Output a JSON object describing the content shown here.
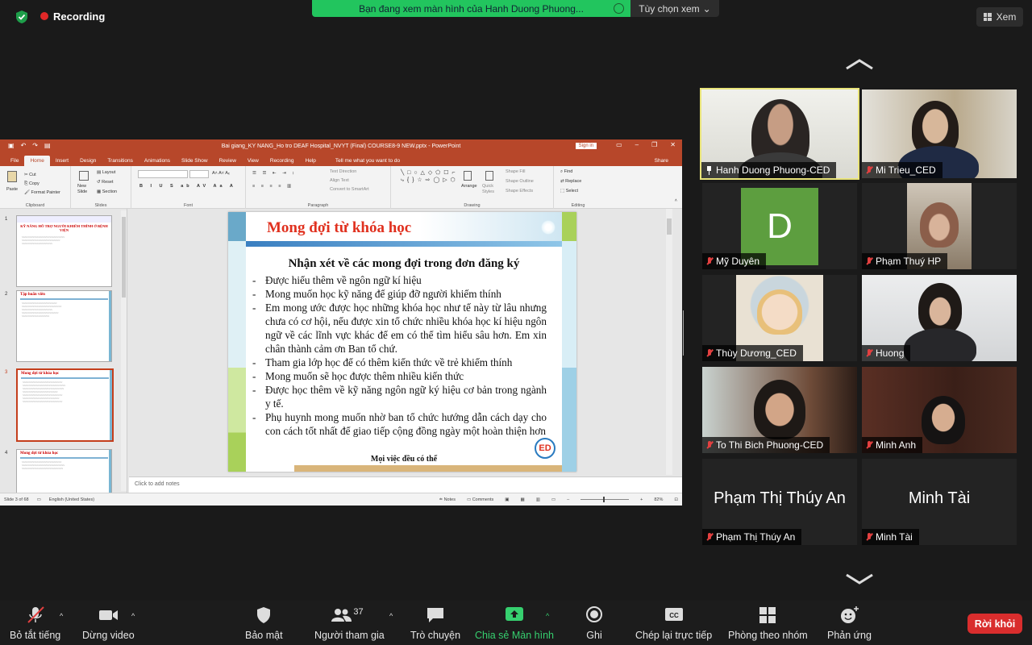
{
  "top": {
    "recording_label": "Recording",
    "share_banner": "Bạn đang xem màn hình của Hanh Duong Phuong...",
    "view_options": "Tùy chọn xem",
    "view_button": "Xem"
  },
  "ppt": {
    "window_title": "Bai giang_KY NANG_Ho tro DEAF Hospital_NVYT (Final) COURSE8-9 NEW.pptx - PowerPoint",
    "sign_in": "Sign in",
    "tabs": [
      "File",
      "Home",
      "Insert",
      "Design",
      "Transitions",
      "Animations",
      "Slide Show",
      "Review",
      "View",
      "Recording",
      "Help"
    ],
    "active_tab": "Home",
    "tell_me": "Tell me what you want to do",
    "share": "Share",
    "ribbon": {
      "clipboard": "Clipboard",
      "paste": "Paste",
      "cut": "Cut",
      "copy": "Copy",
      "format_painter": "Format Painter",
      "slides": "Slides",
      "new_slide": "New Slide",
      "layout": "Layout",
      "reset": "Reset",
      "section": "Section",
      "font": "Font",
      "paragraph": "Paragraph",
      "text_direction": "Text Direction",
      "align_text": "Align Text",
      "convert_smartart": "Convert to SmartArt",
      "drawing": "Drawing",
      "arrange": "Arrange",
      "quick_styles": "Quick Styles",
      "shape_fill": "Shape Fill",
      "shape_outline": "Shape Outline",
      "shape_effects": "Shape Effects",
      "editing": "Editing",
      "find": "Find",
      "replace": "Replace",
      "select": "Select"
    },
    "thumbnails": [
      {
        "num": "1",
        "title": "KỸ NĂNG HỖ TRỢ NGƯỜI KHIẾM THÍNH Ở BỆNH VIỆN"
      },
      {
        "num": "2",
        "title": "Tập huấn viên"
      },
      {
        "num": "3",
        "title": "Mong đợi từ khóa học"
      },
      {
        "num": "4",
        "title": "Mong đợi từ khóa học"
      }
    ],
    "slide": {
      "title": "Mong đợi từ khóa học",
      "subtitle": "Nhận xét về các mong đợi trong đơn đăng ký",
      "bullets": [
        "Được hiểu thêm về ngôn ngữ kí hiệu",
        "Mong muốn học kỹ năng để giúp đỡ người khiếm thính",
        "Em mong ước được học những khóa học như tế này từ lâu nhưng chưa có cơ hội, nếu được xin tổ chức nhiều khóa học kí hiệu ngôn ngữ về các lĩnh vực khác để em có thể tìm hiểu sâu hơn. Em xin chân thành cảm ơn Ban tổ chứ.",
        "Tham gia lớp học để có thêm kiến thức về trẻ khiếm thính",
        "Mong muốn sẽ học được thêm nhiều kiến thức",
        "Được học thêm về kỹ năng ngôn ngữ ký hiệu cơ bản trong ngành y tế.",
        "Phụ huynh mong muốn nhờ ban tổ chức hướng dẫn cách dạy cho con cách tốt nhất để giao tiếp cộng đồng ngày một hoàn thiện hơn"
      ],
      "footer": "Mọi việc đều có thể",
      "logo_text": "ED"
    },
    "notes_placeholder": "Click to add notes",
    "status": {
      "slide_of": "Slide 3 of 68",
      "language": "English (United States)",
      "notes": "Notes",
      "comments": "Comments",
      "zoom": "82%"
    }
  },
  "participants": [
    {
      "name": "Hanh Duong Phuong-CED",
      "muted": false,
      "pinned": true
    },
    {
      "name": "Mi Trieu_CED",
      "muted": true
    },
    {
      "name": "Mỹ Duyên",
      "muted": true,
      "avatar_letter": "D"
    },
    {
      "name": "Phạm Thuý HP",
      "muted": true
    },
    {
      "name": "Thùy Dương_CED",
      "muted": true
    },
    {
      "name": "Huong",
      "muted": true
    },
    {
      "name": "To Thi Bich Phuong-CED",
      "muted": true
    },
    {
      "name": "Minh Anh",
      "muted": true
    },
    {
      "name": "Phạm Thị Thúy An",
      "muted": true,
      "big_name": "Phạm Thị Thúy An"
    },
    {
      "name": "Minh Tài",
      "muted": true,
      "big_name": "Minh Tài"
    }
  ],
  "toolbar": {
    "unmute_all": "Bỏ tắt tiếng",
    "stop_video": "Dừng video",
    "security": "Bảo mật",
    "participants": "Người tham gia",
    "participant_count": "37",
    "chat": "Trò chuyện",
    "share_screen": "Chia sẻ Màn hình",
    "record": "Ghi",
    "live_transcript": "Chép lại trực tiếp",
    "breakout_rooms": "Phòng theo nhóm",
    "reactions": "Phản ứng",
    "leave": "Rời khỏi"
  },
  "colors": {
    "ppt_accent": "#b7472a",
    "share_green": "#22c55e",
    "leave_red": "#d92d2d",
    "active_tile_border": "#e9e47a",
    "slide_title_red": "#e0301e"
  }
}
